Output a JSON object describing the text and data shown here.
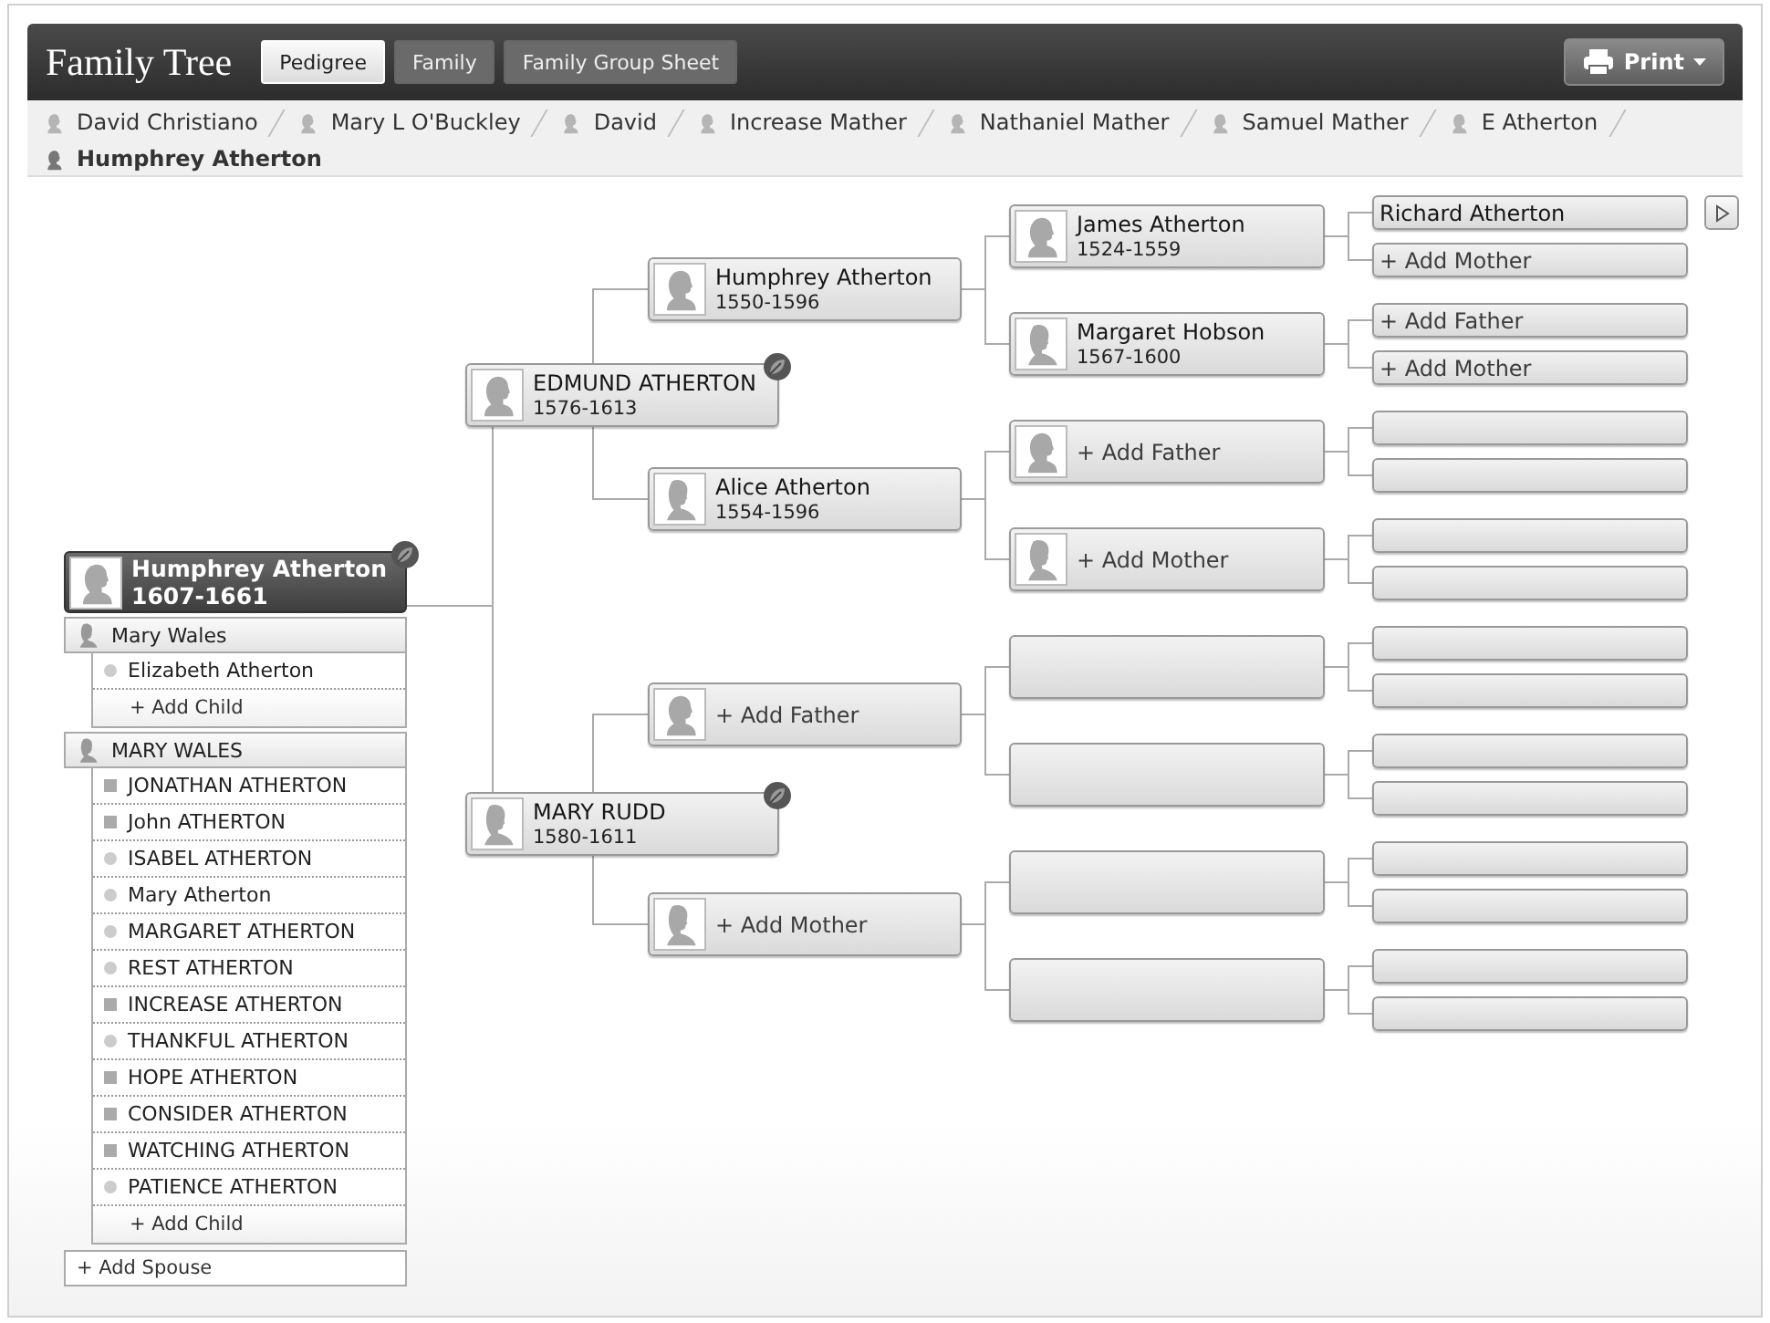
{
  "header": {
    "title": "Family Tree",
    "tabs": [
      {
        "label": "Pedigree",
        "selected": true
      },
      {
        "label": "Family",
        "selected": false
      },
      {
        "label": "Family Group Sheet",
        "selected": false
      }
    ],
    "print_button": "Print"
  },
  "breadcrumbs": [
    {
      "name": "David Christiano",
      "current": false
    },
    {
      "name": "Mary L O'Buckley",
      "current": false
    },
    {
      "name": "David",
      "current": false
    },
    {
      "name": "Increase Mather",
      "current": false
    },
    {
      "name": "Nathaniel Mather",
      "current": false
    },
    {
      "name": "Samuel Mather",
      "current": false
    },
    {
      "name": "E Atherton",
      "current": false
    },
    {
      "name": "Humphrey Atherton",
      "current": true
    }
  ],
  "root": {
    "name": "Humphrey Atherton",
    "years": "1607-1661",
    "female": false,
    "hint": true,
    "parents": [
      {
        "kind": "person",
        "name": "EDMUND ATHERTON",
        "years": "1576-1613",
        "female": false,
        "hint": true,
        "parents": [
          {
            "kind": "person",
            "name": "Humphrey Atherton",
            "years": "1550-1596",
            "female": false,
            "parents": [
              {
                "kind": "person",
                "name": "James Atherton",
                "years": "1524-1559",
                "female": false,
                "parents": [
                  {
                    "kind": "person",
                    "name": "Richard Atherton",
                    "more": true
                  },
                  {
                    "kind": "add",
                    "name": "+ Add Mother"
                  }
                ]
              },
              {
                "kind": "person",
                "name": "Margaret Hobson",
                "years": "1567-1600",
                "female": true,
                "parents": [
                  {
                    "kind": "add",
                    "name": "+ Add Father"
                  },
                  {
                    "kind": "add",
                    "name": "+ Add Mother"
                  }
                ]
              }
            ]
          },
          {
            "kind": "person",
            "name": "Alice Atherton",
            "years": "1554-1596",
            "female": true,
            "parents": [
              {
                "kind": "add",
                "name": "+ Add Father",
                "female": false,
                "parents": [
                  {
                    "kind": "empty"
                  },
                  {
                    "kind": "empty"
                  }
                ]
              },
              {
                "kind": "add",
                "name": "+ Add Mother",
                "female": true,
                "parents": [
                  {
                    "kind": "empty"
                  },
                  {
                    "kind": "empty"
                  }
                ]
              }
            ]
          }
        ]
      },
      {
        "kind": "person",
        "name": "MARY RUDD",
        "years": "1580-1611",
        "female": true,
        "hint": true,
        "parents": [
          {
            "kind": "add",
            "name": "+ Add Father",
            "female": false,
            "parents": [
              {
                "kind": "empty",
                "parents": [
                  {
                    "kind": "empty"
                  },
                  {
                    "kind": "empty"
                  }
                ]
              },
              {
                "kind": "empty",
                "parents": [
                  {
                    "kind": "empty"
                  },
                  {
                    "kind": "empty"
                  }
                ]
              }
            ]
          },
          {
            "kind": "add",
            "name": "+ Add Mother",
            "female": true,
            "parents": [
              {
                "kind": "empty",
                "parents": [
                  {
                    "kind": "empty"
                  },
                  {
                    "kind": "empty"
                  }
                ]
              },
              {
                "kind": "empty",
                "parents": [
                  {
                    "kind": "empty"
                  },
                  {
                    "kind": "empty"
                  }
                ]
              }
            ]
          }
        ]
      }
    ]
  },
  "families": [
    {
      "spouse": "Mary Wales",
      "spouse_female": true,
      "children": [
        {
          "name": "Elizabeth Atherton",
          "female": true
        }
      ],
      "add_child": "+ Add Child"
    },
    {
      "spouse": "MARY WALES",
      "spouse_female": true,
      "children": [
        {
          "name": "JONATHAN ATHERTON",
          "female": false
        },
        {
          "name": "John ATHERTON",
          "female": false
        },
        {
          "name": "ISABEL ATHERTON",
          "female": true
        },
        {
          "name": "Mary Atherton",
          "female": true
        },
        {
          "name": "MARGARET ATHERTON",
          "female": true
        },
        {
          "name": "REST ATHERTON",
          "female": true
        },
        {
          "name": "INCREASE ATHERTON",
          "female": false
        },
        {
          "name": "THANKFUL ATHERTON",
          "female": true
        },
        {
          "name": "HOPE ATHERTON",
          "female": false
        },
        {
          "name": "CONSIDER ATHERTON",
          "female": false
        },
        {
          "name": "WATCHING ATHERTON",
          "female": false
        },
        {
          "name": "PATIENCE ATHERTON",
          "female": true
        }
      ],
      "add_child": "+ Add Child"
    }
  ],
  "add_spouse": "+ Add Spouse"
}
